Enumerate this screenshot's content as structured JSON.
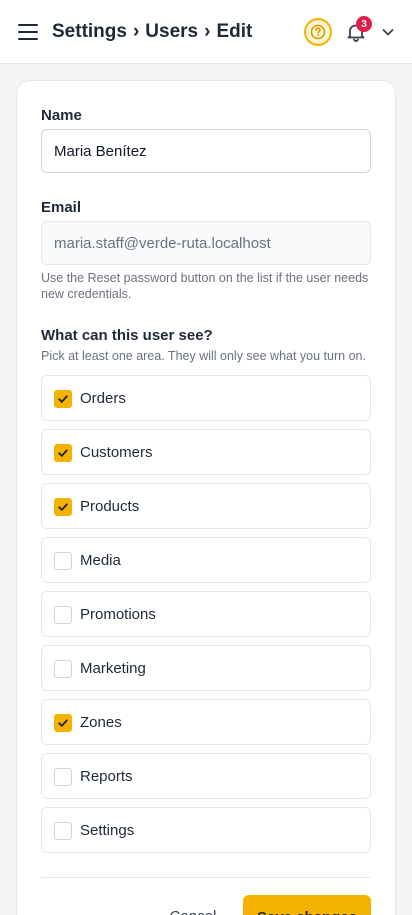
{
  "header": {
    "breadcrumb": [
      "Settings",
      "Users",
      "Edit"
    ],
    "separator": "›",
    "notification_count": "3"
  },
  "form": {
    "name_label": "Name",
    "name_value": "Maria Benítez",
    "email_label": "Email",
    "email_value": "maria.staff@verde-ruta.localhost",
    "email_help": "Use the Reset password button on the list if the user needs new credentials.",
    "areas_title": "What can this user see?",
    "areas_help": "Pick at least one area. They will only see what you turn on.",
    "areas": [
      {
        "label": "Orders",
        "checked": true
      },
      {
        "label": "Customers",
        "checked": true
      },
      {
        "label": "Products",
        "checked": true
      },
      {
        "label": "Media",
        "checked": false
      },
      {
        "label": "Promotions",
        "checked": false
      },
      {
        "label": "Marketing",
        "checked": false
      },
      {
        "label": "Zones",
        "checked": true
      },
      {
        "label": "Reports",
        "checked": false
      },
      {
        "label": "Settings",
        "checked": false
      }
    ],
    "cancel_label": "Cancel",
    "save_label": "Save changes"
  },
  "colors": {
    "accent": "#f5b301",
    "badge": "#e11d48"
  },
  "icons": {
    "menu": "hamburger-menu-icon",
    "help": "help-circle-icon",
    "notifications": "bell-icon",
    "account": "chevron-down-icon",
    "check": "checkmark-icon"
  }
}
